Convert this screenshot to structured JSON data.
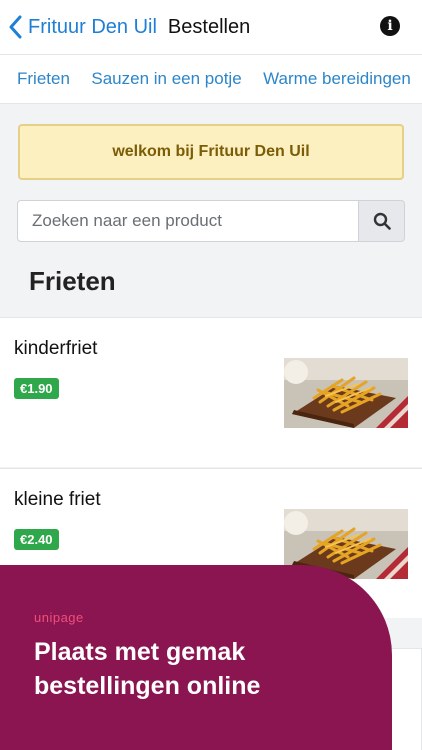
{
  "nav": {
    "back_label": "Frituur Den Uil",
    "title": "Bestellen",
    "info_icon": "info-icon"
  },
  "tabs": [
    {
      "label": "Frieten"
    },
    {
      "label": "Sauzen in een potje"
    },
    {
      "label": "Warme bereidingen"
    }
  ],
  "welcome": "welkom bij Frituur Den Uil",
  "search": {
    "placeholder": "Zoeken naar een product",
    "icon": "search-icon"
  },
  "section_title": "Frieten",
  "products": [
    {
      "name": "kinderfriet",
      "price": "€1.90"
    },
    {
      "name": "kleine friet",
      "price": "€2.40"
    }
  ],
  "promo": {
    "logo": "unipage",
    "text": "Plaats met gemak bestellingen online"
  },
  "colors": {
    "accent": "#1e7fd6",
    "price_badge": "#2ea84b",
    "promo_bg": "#8a1550",
    "welcome_bg": "#fcefc0"
  }
}
